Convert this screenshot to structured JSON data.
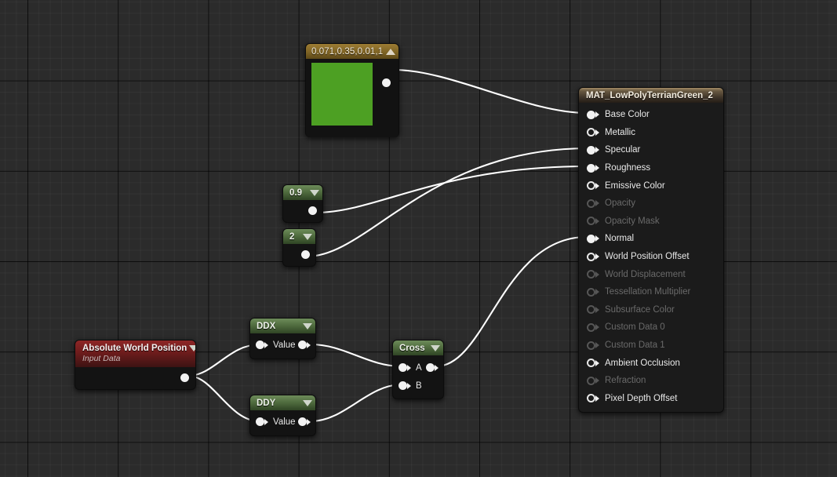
{
  "app": {
    "title": "Unreal Engine Material Graph",
    "background_color": "#2b2b2b",
    "wire_color": "#ffffff"
  },
  "nodes": {
    "constant_color": {
      "title": "0.071,0.35,0.01,1",
      "collapse_icon": "triangle-up-icon",
      "swatch_color": "#4da023",
      "header_color": "#7f6425",
      "output_pin_label": ""
    },
    "constant_roughness": {
      "title": "0.9",
      "collapse_icon": "triangle-down-icon",
      "header_color": "#4f6b3e"
    },
    "constant_specular": {
      "title": "2",
      "collapse_icon": "triangle-down-icon",
      "header_color": "#4f6b3e"
    },
    "absolute_world_position": {
      "title": "Absolute World Position",
      "subtitle": "Input Data",
      "collapse_icon": "triangle-down-icon",
      "header_color": "#6e1c1c"
    },
    "ddx": {
      "title": "DDX",
      "collapse_icon": "triangle-down-icon",
      "input_label": "Value",
      "header_color": "#4f6b3e"
    },
    "ddy": {
      "title": "DDY",
      "collapse_icon": "triangle-down-icon",
      "input_label": "Value",
      "header_color": "#4f6b3e"
    },
    "cross": {
      "title": "Cross",
      "collapse_icon": "triangle-down-icon",
      "input_a_label": "A",
      "input_b_label": "B",
      "header_color": "#4f6b3e"
    },
    "material_output": {
      "title": "MAT_LowPolyTerrianGreen_2",
      "header_color": "#6a5a42",
      "inputs": [
        {
          "label": "Base Color",
          "connected": true,
          "enabled": true
        },
        {
          "label": "Metallic",
          "connected": false,
          "enabled": true
        },
        {
          "label": "Specular",
          "connected": true,
          "enabled": true
        },
        {
          "label": "Roughness",
          "connected": true,
          "enabled": true
        },
        {
          "label": "Emissive Color",
          "connected": false,
          "enabled": true
        },
        {
          "label": "Opacity",
          "connected": false,
          "enabled": false
        },
        {
          "label": "Opacity Mask",
          "connected": false,
          "enabled": false
        },
        {
          "label": "Normal",
          "connected": true,
          "enabled": true
        },
        {
          "label": "World Position Offset",
          "connected": false,
          "enabled": true
        },
        {
          "label": "World Displacement",
          "connected": false,
          "enabled": false
        },
        {
          "label": "Tessellation Multiplier",
          "connected": false,
          "enabled": false
        },
        {
          "label": "Subsurface Color",
          "connected": false,
          "enabled": false
        },
        {
          "label": "Custom Data 0",
          "connected": false,
          "enabled": false
        },
        {
          "label": "Custom Data 1",
          "connected": false,
          "enabled": false
        },
        {
          "label": "Ambient Occlusion",
          "connected": false,
          "enabled": true
        },
        {
          "label": "Refraction",
          "connected": false,
          "enabled": false
        },
        {
          "label": "Pixel Depth Offset",
          "connected": false,
          "enabled": true
        }
      ]
    }
  },
  "connections": [
    {
      "from": "constant_color",
      "to": "material_output.Base Color"
    },
    {
      "from": "constant_specular",
      "to": "material_output.Specular"
    },
    {
      "from": "constant_roughness",
      "to": "material_output.Roughness"
    },
    {
      "from": "cross",
      "to": "material_output.Normal"
    },
    {
      "from": "absolute_world_position",
      "to": "ddx.Value"
    },
    {
      "from": "absolute_world_position",
      "to": "ddy.Value"
    },
    {
      "from": "ddx",
      "to": "cross.A"
    },
    {
      "from": "ddy",
      "to": "cross.B"
    }
  ]
}
